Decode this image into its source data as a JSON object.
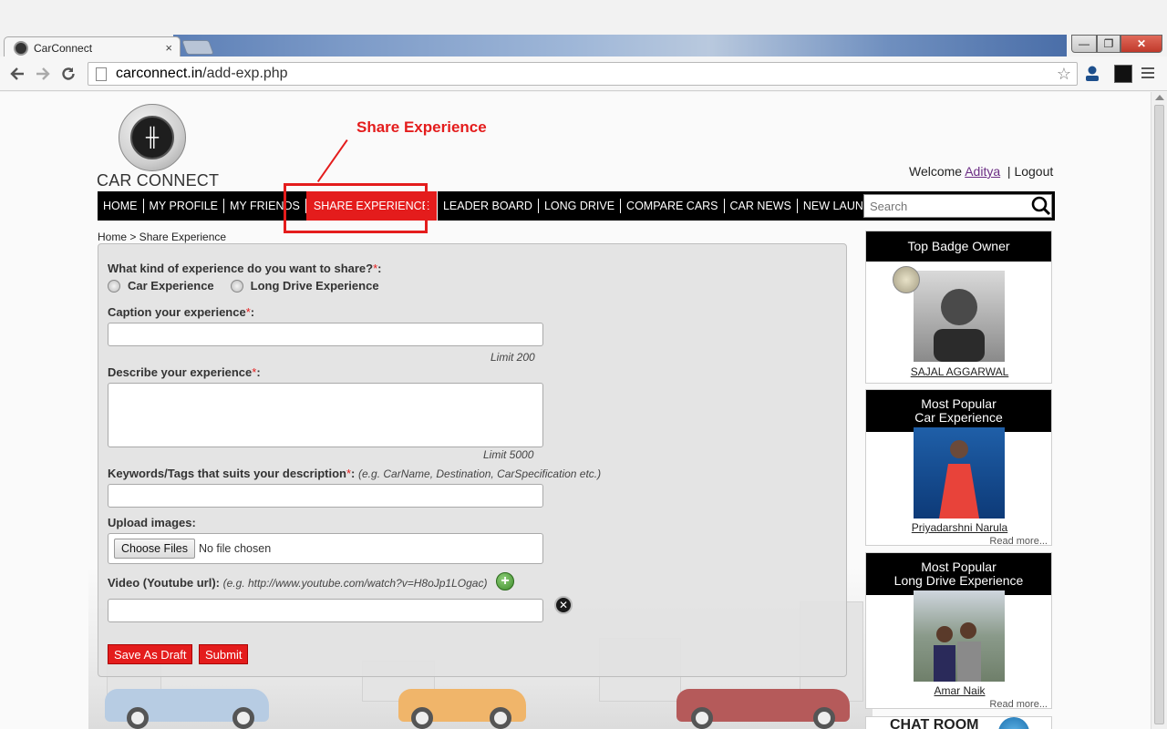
{
  "browser": {
    "tab_title": "CarConnect",
    "tab_close": "×",
    "url_domain": "carconnect.in",
    "url_path": "/add-exp.php",
    "min_glyph": "—",
    "max_glyph": "❐",
    "close_glyph": "✕"
  },
  "header": {
    "logo_text": "CAR CONNECT",
    "logo_knob": "╫",
    "annotation": "Share Experience",
    "welcome_prefix": "Welcome",
    "username": "Aditya",
    "separator": "|",
    "logout": "Logout"
  },
  "nav": {
    "items": [
      "HOME",
      "MY PROFILE",
      "MY FRIENDS",
      "SHARE EXPERIENCE",
      "LEADER BOARD",
      "LONG DRIVE",
      "COMPARE CARS",
      "CAR NEWS",
      "NEW LAUNCHES"
    ],
    "search_placeholder": "Search"
  },
  "breadcrumb": "Home > Share Experience",
  "form": {
    "q_type": "What kind of experience do you want to share?",
    "req": "*",
    "colon": ":",
    "opt_car": "Car Experience",
    "opt_long": "Long Drive Experience",
    "caption_label": "Caption your experience",
    "caption_limit": "Limit 200",
    "describe_label": "Describe your experience",
    "describe_limit": "Limit 5000",
    "keywords_label": "Keywords/Tags that suits your description",
    "keywords_hint": "(e.g. CarName, Destination, CarSpecification etc.)",
    "upload_label": "Upload images:",
    "choose_files": "Choose Files",
    "no_file": "No file chosen",
    "video_label": "Video (Youtube url):",
    "video_hint": "(e.g. http://www.youtube.com/watch?v=H8oJp1LOgac)",
    "plus_glyph": "+",
    "remove_glyph": "✕",
    "save_draft": "Save As Draft",
    "submit": "Submit"
  },
  "sidebar": {
    "top_badge_title": "Top Badge Owner",
    "top_badge_name": "SAJAL AGGARWAL",
    "popular_car_title_1": "Most Popular",
    "popular_car_title_2": "Car Experience",
    "popular_car_name": "Priyadarshni Narula",
    "popular_drive_title_1": "Most Popular",
    "popular_drive_title_2": "Long Drive Experience",
    "popular_drive_name": "Amar Naik",
    "read_more": "Read more...",
    "chat_room": "CHAT ROOM"
  },
  "colors": {
    "accent_red": "#e41c1c",
    "nav_bg": "#000000",
    "link_purple": "#6b2d84"
  }
}
